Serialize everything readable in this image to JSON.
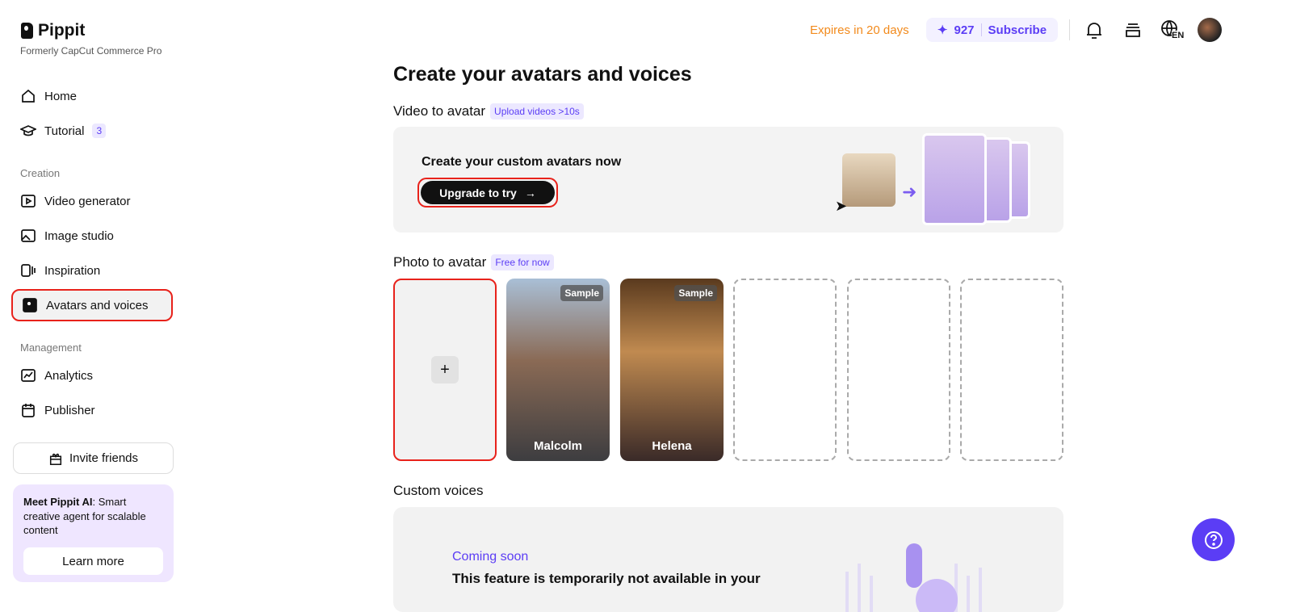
{
  "brand": {
    "name": "Pippit",
    "subtitle": "Formerly CapCut Commerce Pro"
  },
  "sidebar": {
    "home": "Home",
    "tutorial": "Tutorial",
    "tutorial_badge": "3",
    "creation_label": "Creation",
    "video_generator": "Video generator",
    "image_studio": "Image studio",
    "inspiration": "Inspiration",
    "avatars": "Avatars and voices",
    "management_label": "Management",
    "analytics": "Analytics",
    "publisher": "Publisher",
    "invite": "Invite friends",
    "promo_bold": "Meet Pippit AI",
    "promo_text": ": Smart creative agent for scalable content",
    "learn_more": "Learn more"
  },
  "topbar": {
    "expires": "Expires in 20 days",
    "credits": "927",
    "subscribe": "Subscribe",
    "language": "EN"
  },
  "main": {
    "title": "Create your avatars and voices",
    "video_section": "Video to avatar",
    "video_tag": "Upload videos >10s",
    "banner_title": "Create your custom avatars now",
    "upgrade": "Upgrade to try",
    "photo_section": "Photo to avatar",
    "photo_tag": "Free for now",
    "samples": [
      {
        "tag": "Sample",
        "name": "Malcolm"
      },
      {
        "tag": "Sample",
        "name": "Helena"
      }
    ],
    "voices_section": "Custom voices",
    "coming_soon": "Coming soon",
    "unavailable": "This feature is temporarily not available in your"
  }
}
